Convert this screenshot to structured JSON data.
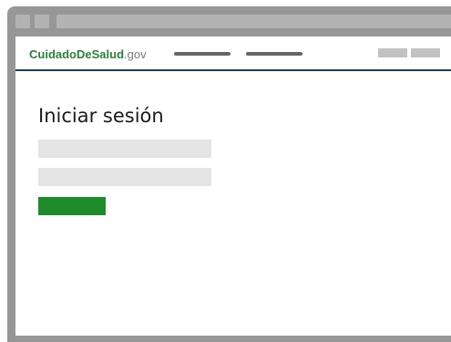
{
  "site": {
    "logo_main": "CuidadoDeSalud",
    "logo_tld": ".gov"
  },
  "main": {
    "title": "Iniciar sesión"
  },
  "colors": {
    "logo_green": "#2f7d3e",
    "header_rule": "#1f3f4f",
    "submit_green": "#1f8a2a",
    "frame_gray": "#979797"
  }
}
